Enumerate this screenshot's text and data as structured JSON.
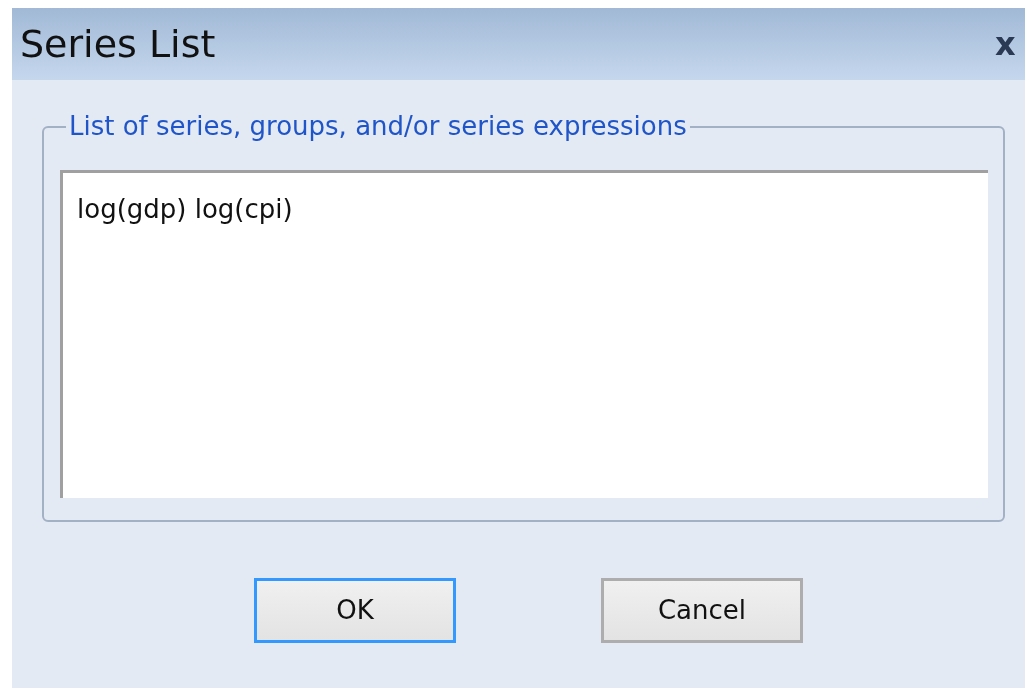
{
  "window": {
    "title": "Series List",
    "close": "x"
  },
  "group": {
    "legend": "List of series, groups, and/or series expressions",
    "value": "log(gdp) log(cpi)"
  },
  "buttons": [
    {
      "label": "OK",
      "default": true
    },
    {
      "label": "Cancel",
      "default": false
    }
  ]
}
